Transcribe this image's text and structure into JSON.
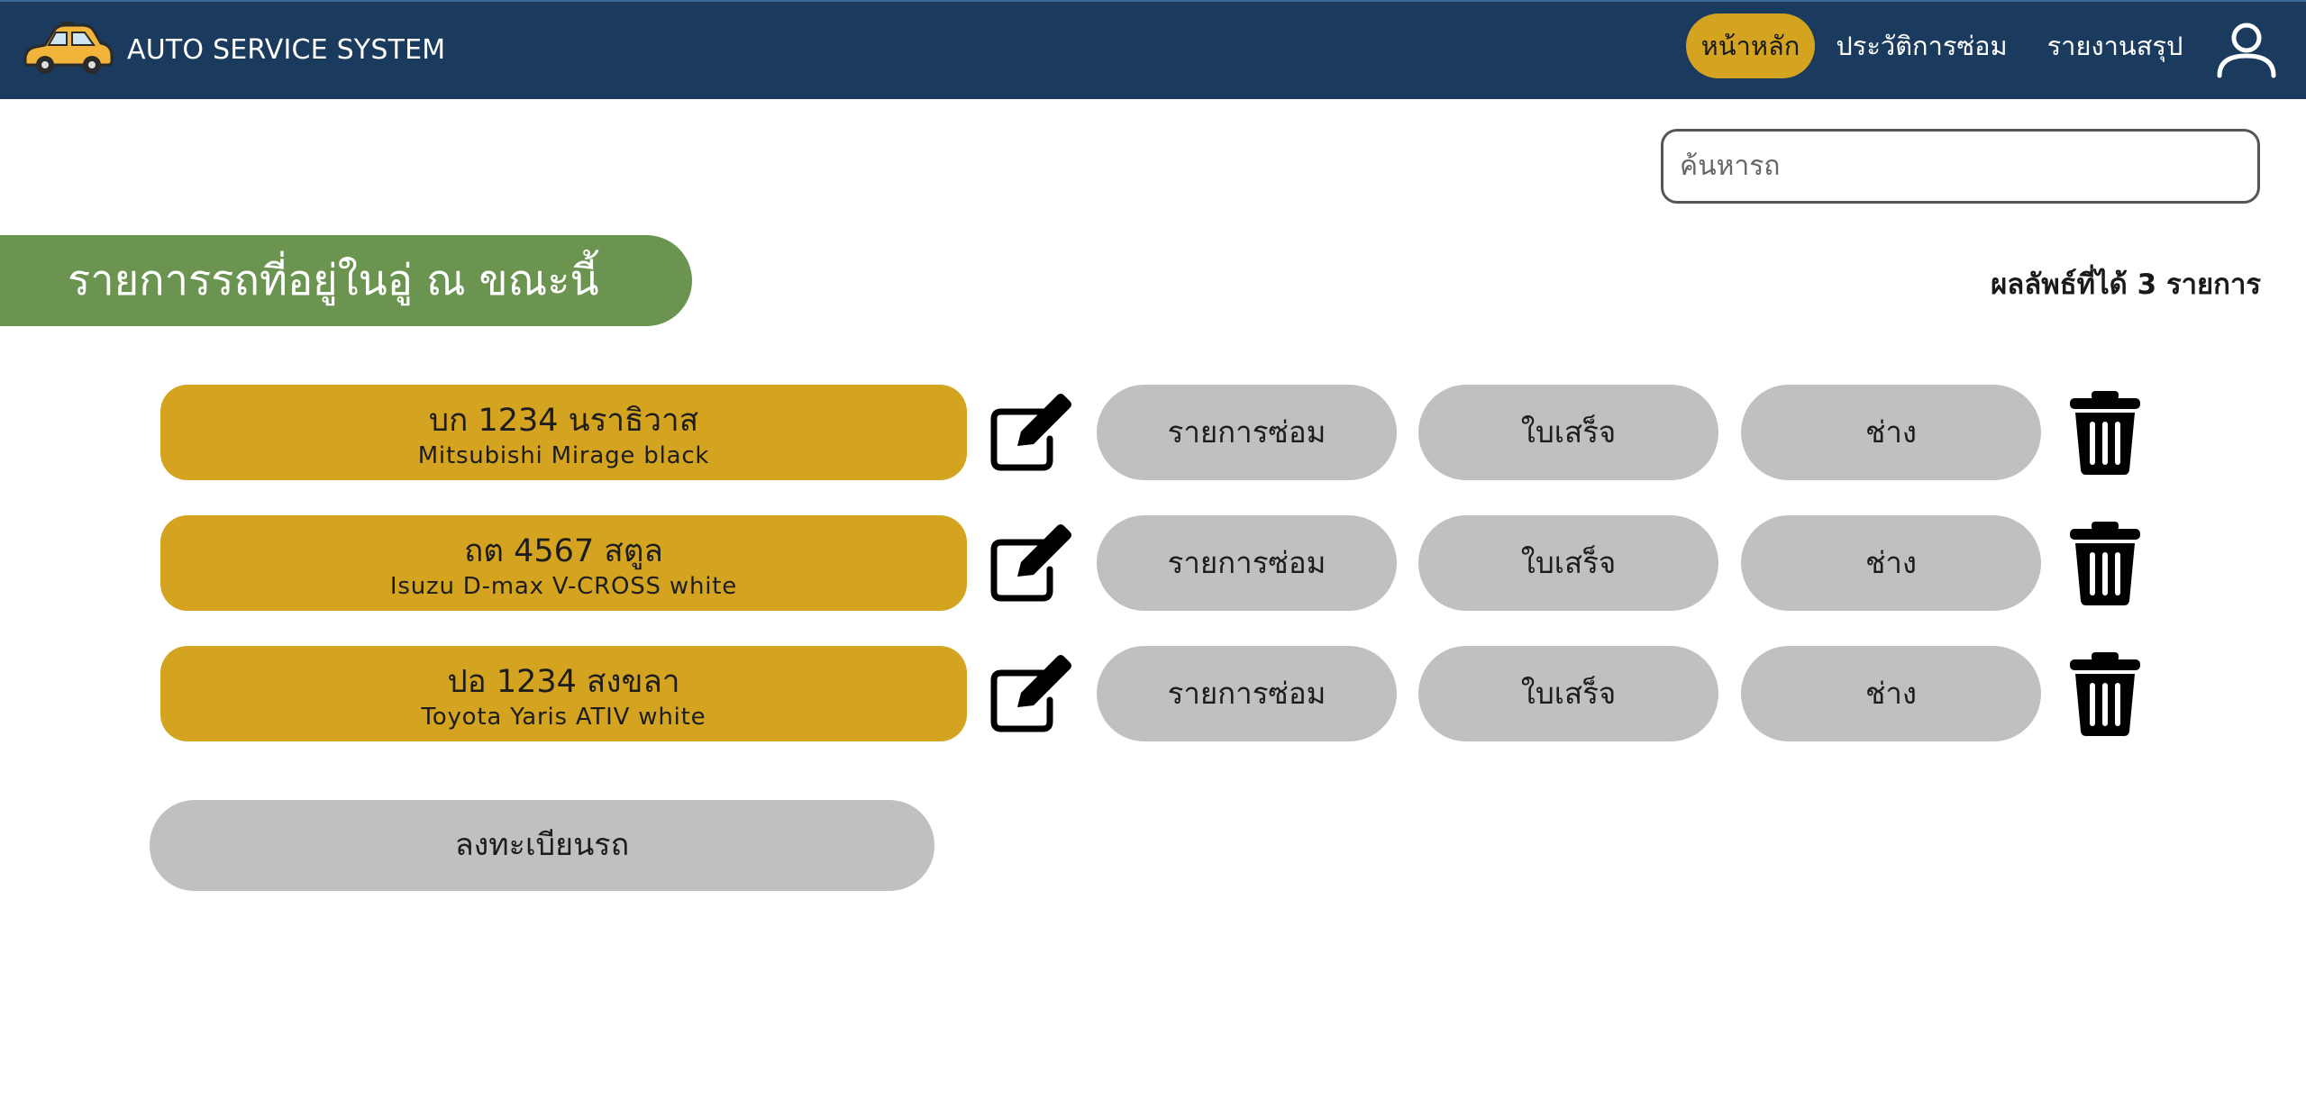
{
  "header": {
    "brand": "AUTO SERVICE SYSTEM",
    "logo_icon": "car-icon",
    "nav": [
      {
        "label": "หน้าหลัก",
        "active": true
      },
      {
        "label": "ประวัติการซ่อม",
        "active": false
      },
      {
        "label": "รายงานสรุป",
        "active": false
      }
    ],
    "user_icon": "user-icon"
  },
  "search": {
    "placeholder": "ค้นหารถ",
    "value": ""
  },
  "section": {
    "title": "รายการรถที่อยู่ในอู่ ณ ขณะนี้",
    "result_text": "ผลลัพธ์ที่ได้ 3 รายการ"
  },
  "cars": [
    {
      "plate": "บก 1234 นราธิวาส",
      "model": "Mitsubishi Mirage black"
    },
    {
      "plate": "ถต 4567 สตูล",
      "model": "Isuzu D-max V-CROSS white"
    },
    {
      "plate": "ปอ 1234 สงขลา",
      "model": "Toyota Yaris ATIV white"
    }
  ],
  "actions": {
    "repair": "รายการซ่อม",
    "receipt": "ใบเสร็จ",
    "mechanic": "ช่าง",
    "edit_icon": "edit-icon",
    "delete_icon": "trash-icon"
  },
  "register_button": "ลงทะเบียนรถ",
  "colors": {
    "navbar": "#1a3a5e",
    "accent_gold": "#d4a421",
    "section_green": "#6a944f",
    "pill_gray": "#c0c0c0"
  }
}
